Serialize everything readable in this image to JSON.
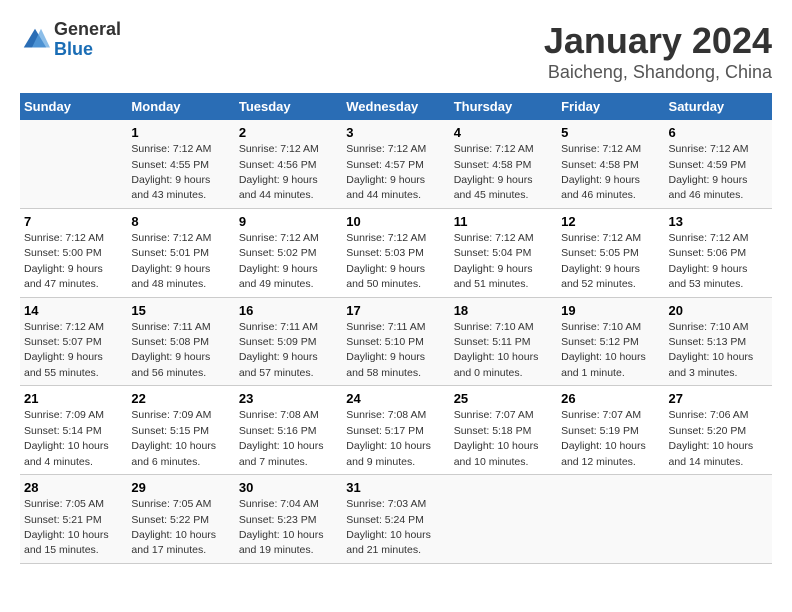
{
  "header": {
    "logo_general": "General",
    "logo_blue": "Blue",
    "title": "January 2024",
    "subtitle": "Baicheng, Shandong, China"
  },
  "weekdays": [
    "Sunday",
    "Monday",
    "Tuesday",
    "Wednesday",
    "Thursday",
    "Friday",
    "Saturday"
  ],
  "weeks": [
    [
      {
        "day": "",
        "info": ""
      },
      {
        "day": "1",
        "info": "Sunrise: 7:12 AM\nSunset: 4:55 PM\nDaylight: 9 hours\nand 43 minutes."
      },
      {
        "day": "2",
        "info": "Sunrise: 7:12 AM\nSunset: 4:56 PM\nDaylight: 9 hours\nand 44 minutes."
      },
      {
        "day": "3",
        "info": "Sunrise: 7:12 AM\nSunset: 4:57 PM\nDaylight: 9 hours\nand 44 minutes."
      },
      {
        "day": "4",
        "info": "Sunrise: 7:12 AM\nSunset: 4:58 PM\nDaylight: 9 hours\nand 45 minutes."
      },
      {
        "day": "5",
        "info": "Sunrise: 7:12 AM\nSunset: 4:58 PM\nDaylight: 9 hours\nand 46 minutes."
      },
      {
        "day": "6",
        "info": "Sunrise: 7:12 AM\nSunset: 4:59 PM\nDaylight: 9 hours\nand 46 minutes."
      }
    ],
    [
      {
        "day": "7",
        "info": "Sunrise: 7:12 AM\nSunset: 5:00 PM\nDaylight: 9 hours\nand 47 minutes."
      },
      {
        "day": "8",
        "info": "Sunrise: 7:12 AM\nSunset: 5:01 PM\nDaylight: 9 hours\nand 48 minutes."
      },
      {
        "day": "9",
        "info": "Sunrise: 7:12 AM\nSunset: 5:02 PM\nDaylight: 9 hours\nand 49 minutes."
      },
      {
        "day": "10",
        "info": "Sunrise: 7:12 AM\nSunset: 5:03 PM\nDaylight: 9 hours\nand 50 minutes."
      },
      {
        "day": "11",
        "info": "Sunrise: 7:12 AM\nSunset: 5:04 PM\nDaylight: 9 hours\nand 51 minutes."
      },
      {
        "day": "12",
        "info": "Sunrise: 7:12 AM\nSunset: 5:05 PM\nDaylight: 9 hours\nand 52 minutes."
      },
      {
        "day": "13",
        "info": "Sunrise: 7:12 AM\nSunset: 5:06 PM\nDaylight: 9 hours\nand 53 minutes."
      }
    ],
    [
      {
        "day": "14",
        "info": "Sunrise: 7:12 AM\nSunset: 5:07 PM\nDaylight: 9 hours\nand 55 minutes."
      },
      {
        "day": "15",
        "info": "Sunrise: 7:11 AM\nSunset: 5:08 PM\nDaylight: 9 hours\nand 56 minutes."
      },
      {
        "day": "16",
        "info": "Sunrise: 7:11 AM\nSunset: 5:09 PM\nDaylight: 9 hours\nand 57 minutes."
      },
      {
        "day": "17",
        "info": "Sunrise: 7:11 AM\nSunset: 5:10 PM\nDaylight: 9 hours\nand 58 minutes."
      },
      {
        "day": "18",
        "info": "Sunrise: 7:10 AM\nSunset: 5:11 PM\nDaylight: 10 hours\nand 0 minutes."
      },
      {
        "day": "19",
        "info": "Sunrise: 7:10 AM\nSunset: 5:12 PM\nDaylight: 10 hours\nand 1 minute."
      },
      {
        "day": "20",
        "info": "Sunrise: 7:10 AM\nSunset: 5:13 PM\nDaylight: 10 hours\nand 3 minutes."
      }
    ],
    [
      {
        "day": "21",
        "info": "Sunrise: 7:09 AM\nSunset: 5:14 PM\nDaylight: 10 hours\nand 4 minutes."
      },
      {
        "day": "22",
        "info": "Sunrise: 7:09 AM\nSunset: 5:15 PM\nDaylight: 10 hours\nand 6 minutes."
      },
      {
        "day": "23",
        "info": "Sunrise: 7:08 AM\nSunset: 5:16 PM\nDaylight: 10 hours\nand 7 minutes."
      },
      {
        "day": "24",
        "info": "Sunrise: 7:08 AM\nSunset: 5:17 PM\nDaylight: 10 hours\nand 9 minutes."
      },
      {
        "day": "25",
        "info": "Sunrise: 7:07 AM\nSunset: 5:18 PM\nDaylight: 10 hours\nand 10 minutes."
      },
      {
        "day": "26",
        "info": "Sunrise: 7:07 AM\nSunset: 5:19 PM\nDaylight: 10 hours\nand 12 minutes."
      },
      {
        "day": "27",
        "info": "Sunrise: 7:06 AM\nSunset: 5:20 PM\nDaylight: 10 hours\nand 14 minutes."
      }
    ],
    [
      {
        "day": "28",
        "info": "Sunrise: 7:05 AM\nSunset: 5:21 PM\nDaylight: 10 hours\nand 15 minutes."
      },
      {
        "day": "29",
        "info": "Sunrise: 7:05 AM\nSunset: 5:22 PM\nDaylight: 10 hours\nand 17 minutes."
      },
      {
        "day": "30",
        "info": "Sunrise: 7:04 AM\nSunset: 5:23 PM\nDaylight: 10 hours\nand 19 minutes."
      },
      {
        "day": "31",
        "info": "Sunrise: 7:03 AM\nSunset: 5:24 PM\nDaylight: 10 hours\nand 21 minutes."
      },
      {
        "day": "",
        "info": ""
      },
      {
        "day": "",
        "info": ""
      },
      {
        "day": "",
        "info": ""
      }
    ]
  ]
}
